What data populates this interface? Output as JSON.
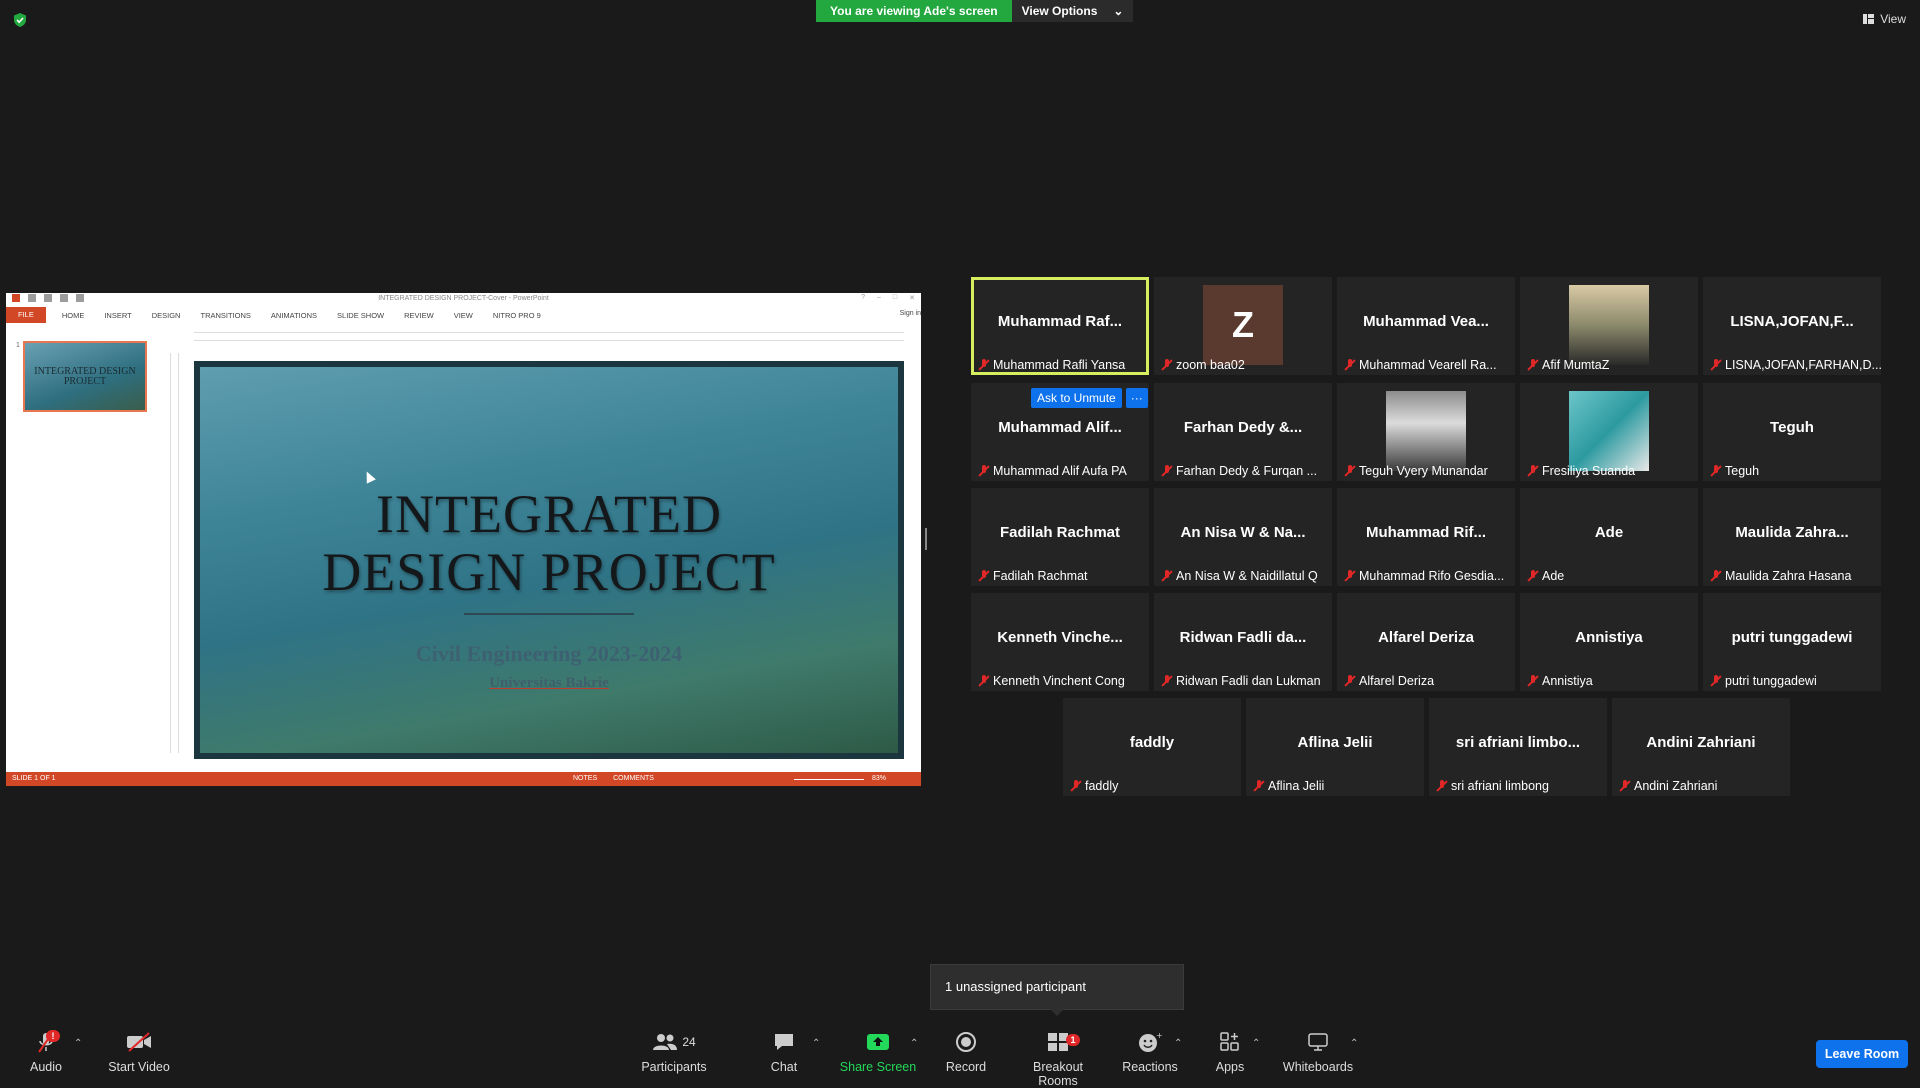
{
  "top": {
    "viewing_text": "You are viewing Ade's screen",
    "view_options": "View Options",
    "view_button": "View"
  },
  "powerpoint": {
    "window_title": "INTEGRATED DESIGN PROJECT-Cover - PowerPoint",
    "sign_in": "Sign in",
    "menu": [
      "FILE",
      "HOME",
      "INSERT",
      "DESIGN",
      "TRANSITIONS",
      "ANIMATIONS",
      "SLIDE SHOW",
      "REVIEW",
      "VIEW",
      "NITRO PRO 9"
    ],
    "thumb_number": "1",
    "thumb_title": "INTEGRATED DESIGN PROJECT",
    "slide_title_line1": "INTEGRATED",
    "slide_title_line2": "DESIGN PROJECT",
    "slide_subtitle": "Civil Engineering 2023-2024",
    "slide_university": "Universitas Bakrie",
    "status_slide": "SLIDE 1 OF 1",
    "status_notes": "NOTES",
    "status_comments": "COMMENTS",
    "zoom": "83%",
    "accent": "#d24726"
  },
  "participants": [
    {
      "big": "Muhammad Raf...",
      "name": "Muhammad Rafli Yansa"
    },
    {
      "big": "Z",
      "name": "zoom baa02"
    },
    {
      "big": "Muhammad Vea...",
      "name": "Muhammad Vearell Ra..."
    },
    {
      "big": "",
      "name": "Afif MumtaZ"
    },
    {
      "big": "LISNA,JOFAN,F...",
      "name": "LISNA,JOFAN,FARHAN,D..."
    },
    {
      "big": "Muhammad Alif...",
      "name": "Muhammad Alif Aufa PA"
    },
    {
      "big": "Farhan Dedy &...",
      "name": "Farhan Dedy & Furqan ..."
    },
    {
      "big": "",
      "name": "Teguh Vyery Munandar"
    },
    {
      "big": "",
      "name": "Fresiliya Suanda"
    },
    {
      "big": "Teguh",
      "name": "Teguh"
    },
    {
      "big": "Fadilah Rachmat",
      "name": "Fadilah Rachmat"
    },
    {
      "big": "An Nisa W & Na...",
      "name": "An Nisa W & Naidillatul Q"
    },
    {
      "big": "Muhammad Rif...",
      "name": "Muhammad Rifo Gesdia..."
    },
    {
      "big": "Ade",
      "name": "Ade"
    },
    {
      "big": "Maulida Zahra...",
      "name": "Maulida Zahra Hasana"
    },
    {
      "big": "Kenneth Vinche...",
      "name": "Kenneth Vinchent Cong"
    },
    {
      "big": "Ridwan Fadli da...",
      "name": "Ridwan Fadli dan Lukman"
    },
    {
      "big": "Alfarel Deriza",
      "name": "Alfarel Deriza"
    },
    {
      "big": "Annistiya",
      "name": "Annistiya"
    },
    {
      "big": "putri tunggadewi",
      "name": "putri tunggadewi"
    },
    {
      "big": "faddly",
      "name": "faddly"
    },
    {
      "big": "Aflina Jelii",
      "name": "Aflina Jelii"
    },
    {
      "big": "sri afriani limbo...",
      "name": "sri afriani limbong"
    },
    {
      "big": "Andini Zahriani",
      "name": "Andini Zahriani"
    }
  ],
  "hover": {
    "ask_unmute": "Ask to Unmute",
    "more": "···"
  },
  "toast": "1 unassigned participant",
  "toolbar": {
    "audio": "Audio",
    "audio_badge": "!",
    "video": "Start Video",
    "participants": "Participants",
    "participants_count": "24",
    "chat": "Chat",
    "share": "Share Screen",
    "record": "Record",
    "breakout": "Breakout Rooms",
    "breakout_badge": "1",
    "reactions": "Reactions",
    "apps": "Apps",
    "whiteboards": "Whiteboards",
    "leave": "Leave Room"
  },
  "colors": {
    "zoom_blue": "#0e72ed",
    "share_green": "#23d959",
    "active_speaker": "#d4ee5f",
    "mute_red": "#e02828"
  }
}
